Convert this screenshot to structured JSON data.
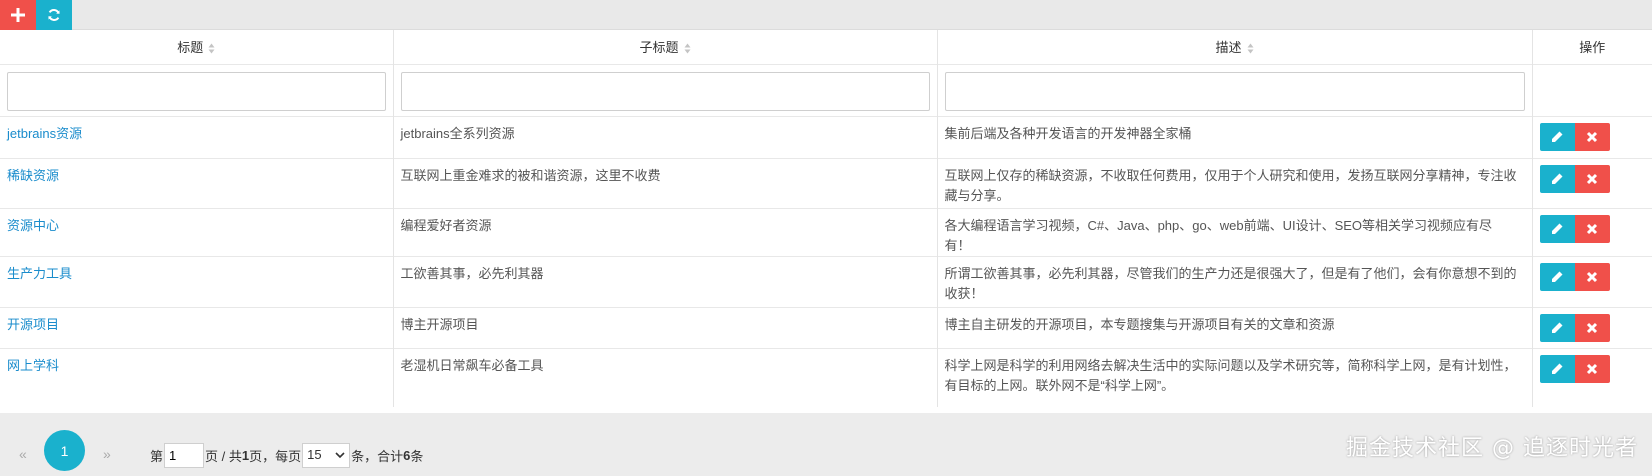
{
  "toolbar": {
    "add_icon": "plus-icon",
    "refresh_icon": "refresh-icon",
    "add_color": "#f0504a",
    "refresh_color": "#1ab1cd"
  },
  "table": {
    "columns": [
      {
        "label": "标题",
        "sortable": true
      },
      {
        "label": "子标题",
        "sortable": true
      },
      {
        "label": "描述",
        "sortable": true
      },
      {
        "label": "操作",
        "sortable": false
      }
    ],
    "filters": {
      "title": "",
      "subtitle": "",
      "description": ""
    },
    "rows": [
      {
        "title": "jetbrains资源",
        "subtitle": "jetbrains全系列资源",
        "description": "集前后端及各种开发语言的开发神器全家桶"
      },
      {
        "title": "稀缺资源",
        "subtitle": "互联网上重金难求的被和谐资源，这里不收费",
        "description": "互联网上仅存的稀缺资源，不收取任何费用，仅用于个人研究和使用，发扬互联网分享精神，专注收藏与分享。"
      },
      {
        "title": "资源中心",
        "subtitle": "编程爱好者资源",
        "description": "各大编程语言学习视频，C#、Java、php、go、web前端、UI设计、SEO等相关学习视频应有尽有！"
      },
      {
        "title": "生产力工具",
        "subtitle": "工欲善其事，必先利其器",
        "description": "所谓工欲善其事，必先利其器，尽管我们的生产力还是很强大了，但是有了他们，会有你意想不到的收获！"
      },
      {
        "title": "开源项目",
        "subtitle": "博主开源项目",
        "description": "博主自主研发的开源项目，本专题搜集与开源项目有关的文章和资源"
      },
      {
        "title": "网上学科",
        "subtitle": "老湿机日常飙车必备工具",
        "description": "科学上网是科学的利用网络去解决生活中的实际问题以及学术研究等，简称科学上网，是有计划性，有目标的上网。联外网不是“科学上网”。"
      }
    ],
    "edit_color": "#1ab1cd",
    "delete_color": "#f0504a",
    "link_color": "#1a8ccc"
  },
  "pager": {
    "prev": "«",
    "current": "1",
    "next": "»",
    "label_page_prefix": "第",
    "page_input_value": "1",
    "label_total_prefix": "页 / 共",
    "total_pages": "1",
    "label_per_page": "页，每页",
    "page_size": "15",
    "label_items": "条，合计",
    "total_items": "6",
    "label_items_suffix": "条"
  },
  "watermark": "掘金技术社区 @ 追逐时光者"
}
